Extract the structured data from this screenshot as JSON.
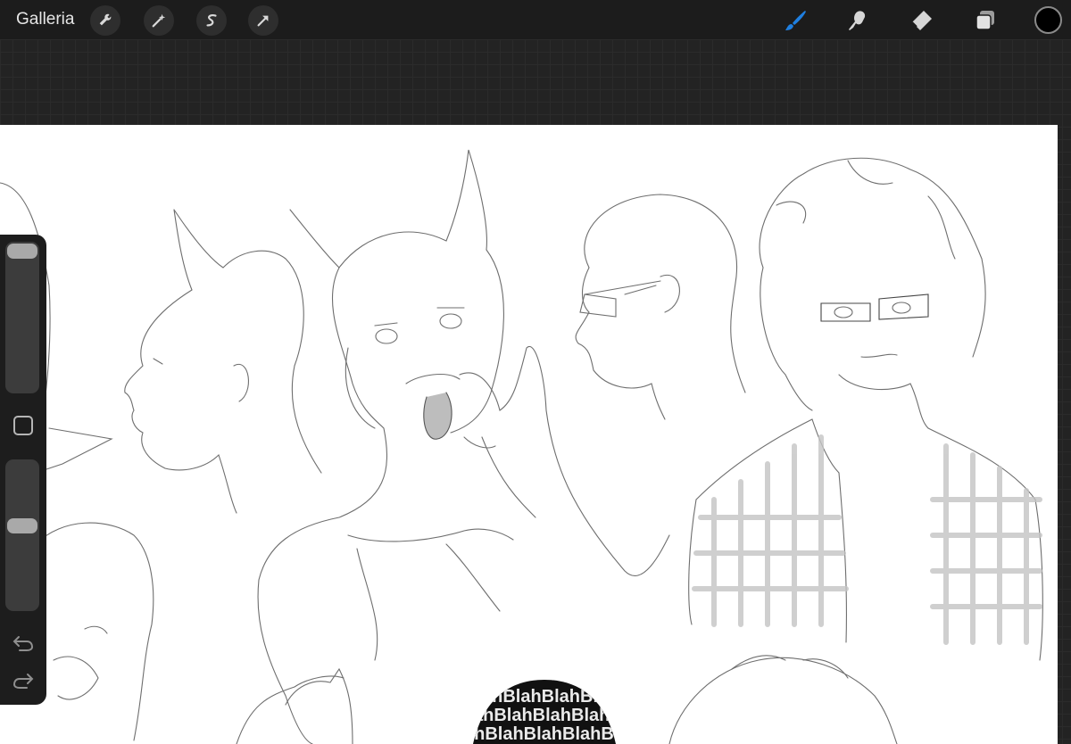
{
  "toolbar": {
    "gallery_label": "Galleria",
    "left_tools": [
      "wrench-icon",
      "magic-wand-icon",
      "selection-icon",
      "transform-arrow-icon"
    ],
    "right_tools": [
      "brush-icon",
      "smudge-icon",
      "eraser-icon",
      "layers-icon"
    ],
    "active_tool": "brush",
    "accent_color": "#1f7fe0",
    "current_color": "#000000"
  },
  "sidebar": {
    "brush_size_slider_level": 0.0,
    "opacity_slider_level": 0.55,
    "modify_button": "square-icon",
    "undo": "undo-icon",
    "redo": "redo-icon"
  },
  "canvas": {
    "pattern_text": "BlahBlahBlahBlahBlahBlahBla"
  }
}
